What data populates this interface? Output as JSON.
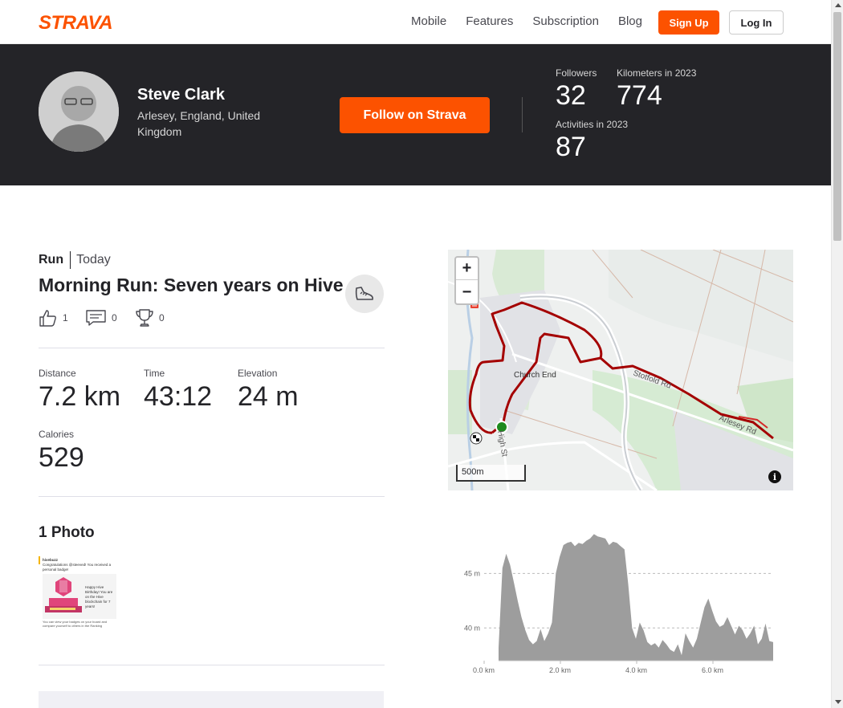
{
  "nav": {
    "logo": "STRAVA",
    "links": [
      "Mobile",
      "Features",
      "Subscription",
      "Blog"
    ],
    "signup": "Sign Up",
    "login": "Log In"
  },
  "athlete": {
    "name": "Steve Clark",
    "location": "Arlesey, England, United Kingdom",
    "follow": "Follow on Strava",
    "stats": {
      "followers_label": "Followers",
      "followers": "32",
      "km_label": "Kilometers in 2023",
      "km": "774",
      "activities_label": "Activities in 2023",
      "activities": "87"
    }
  },
  "activity": {
    "type": "Run",
    "when": "Today",
    "title": "Morning Run: Seven years on Hive",
    "kudos": "1",
    "comments": "0",
    "achievements": "0",
    "metrics": {
      "distance_label": "Distance",
      "distance": "7.2 km",
      "time_label": "Time",
      "time": "43:12",
      "elevation_label": "Elevation",
      "elevation": "24 m",
      "calories_label": "Calories",
      "calories": "529"
    },
    "photos_title": "1 Photo"
  },
  "photo": {
    "user": "hivebuzz",
    "text1": "Congratulations @steeved! You received a personal badge!",
    "text2": "Happy Hive Birthday! You are on the Hive blockchain for 7 years!",
    "text3": "You can view your badges on your board and compare yourself to others in the Ranking"
  },
  "map": {
    "zoom_in": "+",
    "zoom_out": "−",
    "scale": "500m",
    "info": "i",
    "labels": {
      "church_end": "Church End",
      "stotfold_rd": "Stotfold Rd",
      "arlesey_rd": "Arlesey Rd",
      "high_st": "High St"
    }
  },
  "chart_data": {
    "type": "area",
    "xlabel": "",
    "ylabel": "",
    "x_ticks": [
      "0.0 km",
      "2.0 km",
      "4.0 km",
      "6.0 km"
    ],
    "y_ticks": [
      "45 m",
      "40 m"
    ],
    "xlim": [
      0,
      7.2
    ],
    "ylim": [
      37,
      49
    ],
    "grid": true,
    "series": [
      {
        "x": [
          0.0,
          0.1,
          0.2,
          0.3,
          0.4,
          0.5,
          0.6,
          0.7,
          0.8,
          0.9,
          1.0,
          1.1,
          1.2,
          1.3,
          1.4,
          1.5,
          1.6,
          1.7,
          1.8,
          1.9,
          2.0,
          2.1,
          2.2,
          2.3,
          2.4,
          2.5,
          2.6,
          2.7,
          2.8,
          2.9,
          3.0,
          3.1,
          3.2,
          3.3,
          3.4,
          3.5,
          3.6,
          3.7,
          3.8,
          3.9,
          4.0,
          4.1,
          4.2,
          4.3,
          4.4,
          4.5,
          4.6,
          4.7,
          4.8,
          4.9,
          5.0,
          5.1,
          5.2,
          5.3,
          5.4,
          5.5,
          5.6,
          5.7,
          5.8,
          5.9,
          6.0,
          6.1,
          6.2,
          6.3,
          6.4,
          6.5,
          6.6,
          6.7,
          6.8,
          6.9,
          7.0,
          7.1,
          7.2
        ],
        "y": [
          38.2,
          45.5,
          46.8,
          45.8,
          44.2,
          42.5,
          41.0,
          39.8,
          38.9,
          38.5,
          38.8,
          39.9,
          38.8,
          39.5,
          40.5,
          45.0,
          46.5,
          47.6,
          47.8,
          47.9,
          47.5,
          47.8,
          47.7,
          48.0,
          48.2,
          48.6,
          48.4,
          48.3,
          48.2,
          47.6,
          47.9,
          47.8,
          47.5,
          47.2,
          44.0,
          40.0,
          39.0,
          40.5,
          39.8,
          38.7,
          38.4,
          38.6,
          38.2,
          38.9,
          38.5,
          38.0,
          37.8,
          38.5,
          37.5,
          39.5,
          38.8,
          38.2,
          39.0,
          40.5,
          41.9,
          42.7,
          41.6,
          40.6,
          40.1,
          40.3,
          41.0,
          40.2,
          39.4,
          40.2,
          39.8,
          39.0,
          39.5,
          40.2,
          38.5,
          39.0,
          40.4,
          38.8,
          38.7
        ]
      }
    ]
  }
}
